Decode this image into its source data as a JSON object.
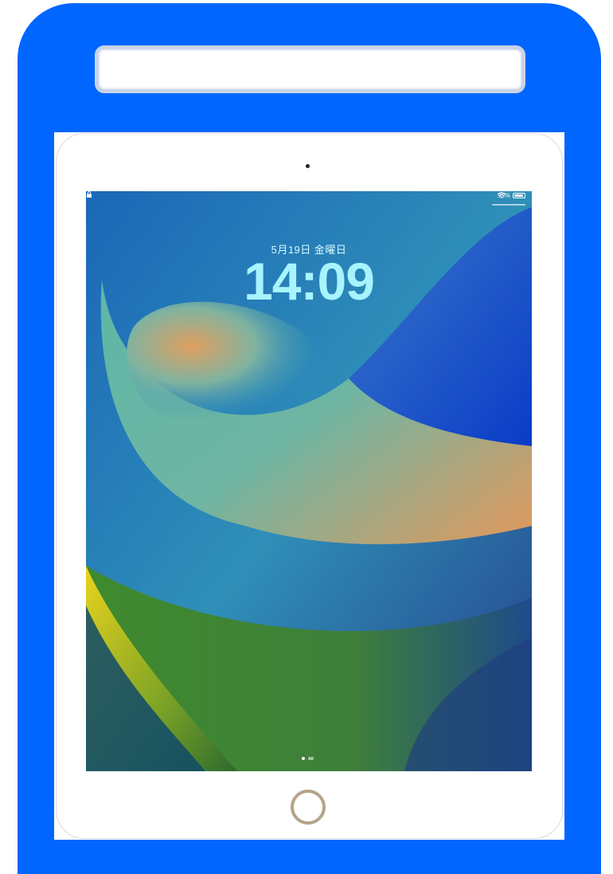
{
  "colors": {
    "case": "#0066ff",
    "label_border": "#c8d3e6",
    "home_ring": "#b5a48a",
    "time_text": "#a7f4ff"
  },
  "status_bar": {
    "battery_text": "93%",
    "battery_level": 0.93,
    "icons": [
      "lock-icon",
      "wifi-icon",
      "battery-icon"
    ]
  },
  "lock_screen": {
    "date": "5月19日 金曜日",
    "time": "14:09"
  },
  "page_indicator": {
    "icons": [
      "page-dot",
      "camera-page-icon"
    ]
  }
}
